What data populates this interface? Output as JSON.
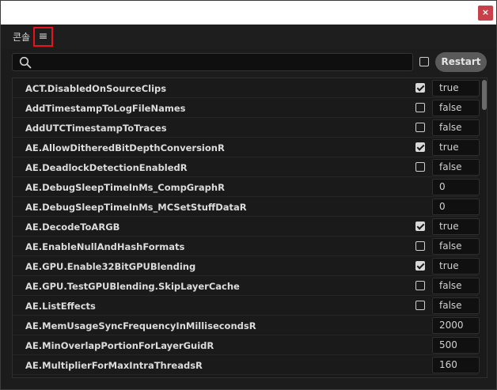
{
  "window": {
    "close_label": "×"
  },
  "panel": {
    "title": "콘솔",
    "menu_glyph": "≡"
  },
  "search": {
    "placeholder": "",
    "value": ""
  },
  "toolbar": {
    "restart_label": "Restart",
    "option_checked": false
  },
  "settings": [
    {
      "name": "ACT.DisabledOnSourceClips",
      "has_checkbox": true,
      "checked": true,
      "value": "true"
    },
    {
      "name": "AddTimestampToLogFileNames",
      "has_checkbox": true,
      "checked": false,
      "value": "false"
    },
    {
      "name": "AddUTCTimestampToTraces",
      "has_checkbox": true,
      "checked": false,
      "value": "false"
    },
    {
      "name": "AE.AllowDitheredBitDepthConversionR",
      "has_checkbox": true,
      "checked": true,
      "value": "true"
    },
    {
      "name": "AE.DeadlockDetectionEnabledR",
      "has_checkbox": true,
      "checked": false,
      "value": "false"
    },
    {
      "name": "AE.DebugSleepTimeInMs_CompGraphR",
      "has_checkbox": false,
      "checked": false,
      "value": "0"
    },
    {
      "name": "AE.DebugSleepTimeInMs_MCSetStuffDataR",
      "has_checkbox": false,
      "checked": false,
      "value": "0"
    },
    {
      "name": "AE.DecodeToARGB",
      "has_checkbox": true,
      "checked": true,
      "value": "true"
    },
    {
      "name": "AE.EnableNullAndHashFormats",
      "has_checkbox": true,
      "checked": false,
      "value": "false"
    },
    {
      "name": "AE.GPU.Enable32BitGPUBlending",
      "has_checkbox": true,
      "checked": true,
      "value": "true"
    },
    {
      "name": "AE.GPU.TestGPUBlending.SkipLayerCache",
      "has_checkbox": true,
      "checked": false,
      "value": "false"
    },
    {
      "name": "AE.ListEffects",
      "has_checkbox": true,
      "checked": false,
      "value": "false"
    },
    {
      "name": "AE.MemUsageSyncFrequencyInMillisecondsR",
      "has_checkbox": false,
      "checked": false,
      "value": "2000"
    },
    {
      "name": "AE.MinOverlapPortionForLayerGuidR",
      "has_checkbox": false,
      "checked": false,
      "value": "500"
    },
    {
      "name": "AE.MultiplierForMaxIntraThreadsR",
      "has_checkbox": false,
      "checked": false,
      "value": "160"
    }
  ]
}
